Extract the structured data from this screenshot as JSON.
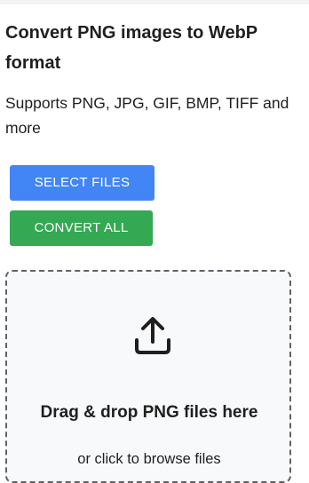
{
  "header": {
    "title": "Convert PNG images to WebP format",
    "subtitle": "Supports PNG, JPG, GIF, BMP, TIFF and more"
  },
  "actions": {
    "select_label": "SELECT FILES",
    "convert_label": "CONVERT ALL"
  },
  "dropzone": {
    "icon": "upload-icon",
    "title": "Drag & drop PNG files here",
    "subtitle": "or click to browse files"
  },
  "colors": {
    "primary": "#4285f4",
    "success": "#34a853",
    "dropzone_border": "#5f6368",
    "dropzone_bg": "#f8f9fa"
  }
}
